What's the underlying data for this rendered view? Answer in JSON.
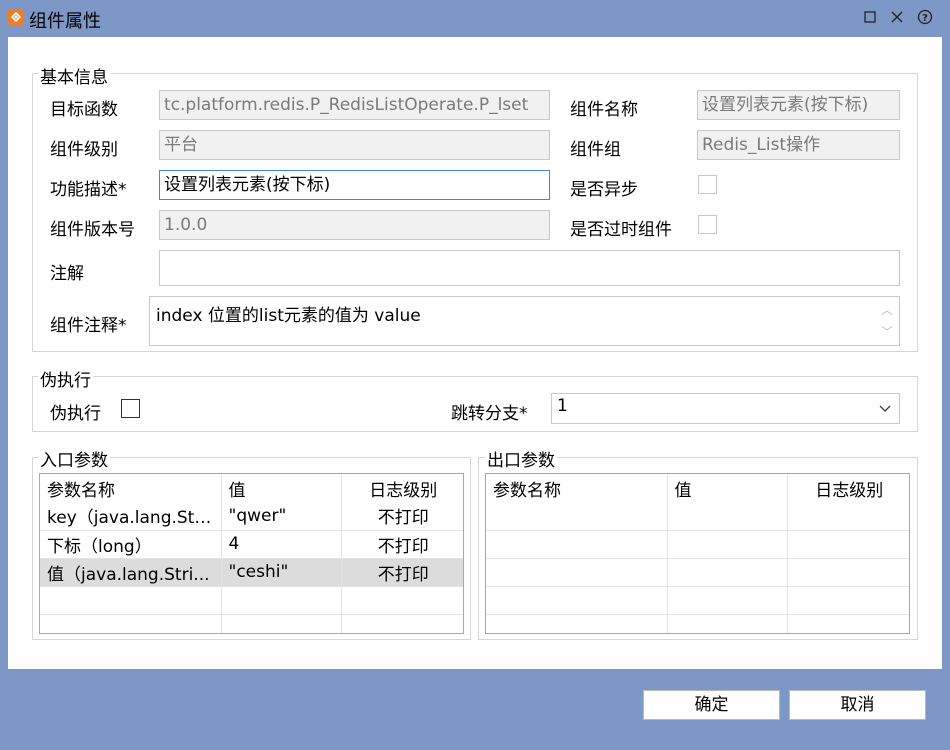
{
  "window": {
    "title": "组件属性",
    "icon": "orange-app-icon",
    "controls": [
      "maximize-icon",
      "close-icon",
      "help-icon"
    ]
  },
  "basic": {
    "legend": "基本信息",
    "target_func": {
      "label": "目标函数",
      "value": "tc.platform.redis.P_RedisListOperate.P_lset"
    },
    "comp_name": {
      "label": "组件名称",
      "value": "设置列表元素(按下标)"
    },
    "comp_level": {
      "label": "组件级别",
      "value": "平台"
    },
    "comp_group": {
      "label": "组件组",
      "value": "Redis_List操作"
    },
    "func_desc": {
      "label": "功能描述*",
      "value": "设置列表元素(按下标)"
    },
    "is_async": {
      "label": "是否异步",
      "checked": false
    },
    "version": {
      "label": "组件版本号",
      "value": "1.0.0"
    },
    "is_deprecated": {
      "label": "是否过时组件",
      "checked": false
    },
    "annotation": {
      "label": "注解",
      "value": ""
    },
    "comp_comment": {
      "label": "组件注释*",
      "value": "index 位置的list元素的值为 value"
    }
  },
  "pseudo": {
    "legend": "伪执行",
    "pseudo_exec": {
      "label": "伪执行",
      "checked": false
    },
    "jump_branch": {
      "label": "跳转分支*",
      "value": "1"
    }
  },
  "input_params": {
    "legend": "入口参数",
    "columns": [
      "参数名称",
      "值",
      "日志级别"
    ],
    "rows": [
      {
        "name": "key（java.lang.Str...",
        "value": "\"qwer\"",
        "log": "不打印"
      },
      {
        "name": "下标（long）",
        "value": "4",
        "log": "不打印"
      },
      {
        "name": "值（java.lang.Stri...",
        "value": "\"ceshi\"",
        "log": "不打印"
      }
    ],
    "selected_row": 2
  },
  "output_params": {
    "legend": "出口参数",
    "columns": [
      "参数名称",
      "值",
      "日志级别"
    ],
    "rows": []
  },
  "buttons": {
    "ok": "确定",
    "cancel": "取消"
  }
}
